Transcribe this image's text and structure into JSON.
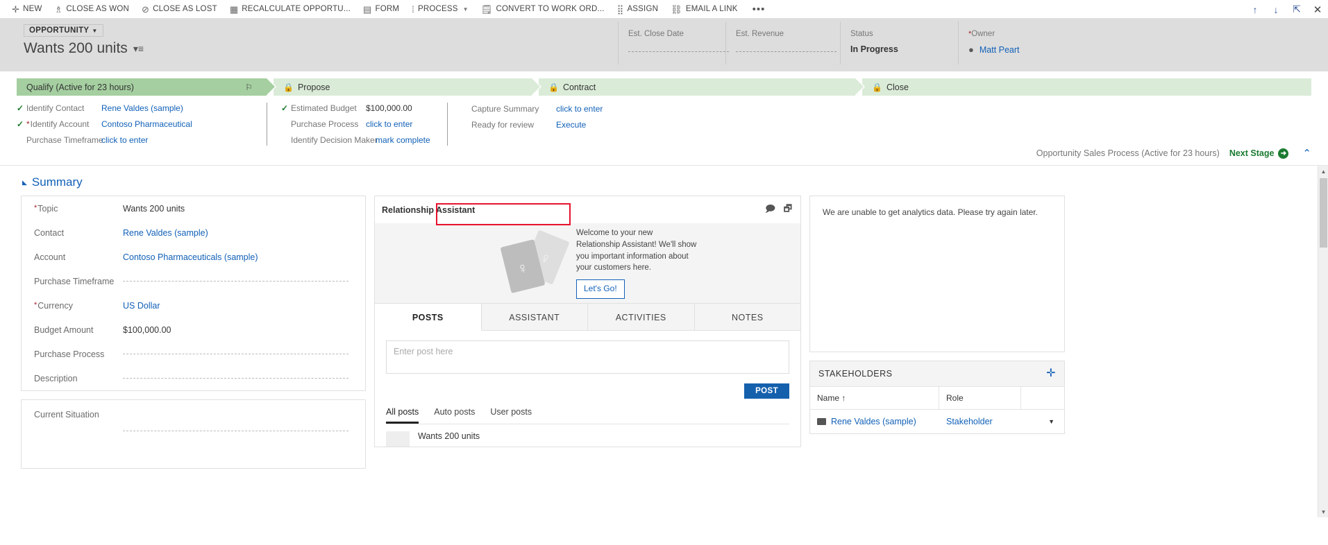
{
  "commandbar": {
    "items": [
      {
        "label": "NEW",
        "icon": "plus-icon",
        "glyph": "✚",
        "caret": false
      },
      {
        "label": "CLOSE AS WON",
        "icon": "trophy-icon",
        "glyph": "🏆",
        "caret": false
      },
      {
        "label": "CLOSE AS LOST",
        "icon": "block-icon",
        "glyph": "🚫",
        "caret": false
      },
      {
        "label": "RECALCULATE OPPORTU...",
        "icon": "calculator-icon",
        "glyph": "🖩",
        "caret": false
      },
      {
        "label": "FORM",
        "icon": "form-icon",
        "glyph": "▤",
        "caret": false
      },
      {
        "label": "PROCESS",
        "icon": "process-icon",
        "glyph": "⁞",
        "caret": true
      },
      {
        "label": "CONVERT TO WORK ORD...",
        "icon": "convert-icon",
        "glyph": "📝",
        "caret": false
      },
      {
        "label": "ASSIGN",
        "icon": "assign-icon",
        "glyph": "👥",
        "caret": false
      },
      {
        "label": "EMAIL A LINK",
        "icon": "link-icon",
        "glyph": "🔗",
        "caret": false
      }
    ],
    "overflow_label": "•••",
    "right_icons": [
      {
        "name": "move-up-icon",
        "glyph": "↑"
      },
      {
        "name": "move-down-icon",
        "glyph": "↓"
      },
      {
        "name": "popout-icon",
        "glyph": "⇱"
      },
      {
        "name": "close-icon",
        "glyph": "✕"
      }
    ]
  },
  "header": {
    "entity_type": "OPPORTUNITY",
    "record_title": "Wants 200 units",
    "fields": [
      {
        "label": "Est. Close Date",
        "value": "",
        "empty": true,
        "required": false,
        "link": false
      },
      {
        "label": "Est. Revenue",
        "value": "",
        "empty": true,
        "required": false,
        "link": false
      },
      {
        "label": "Status",
        "value": "In Progress",
        "empty": false,
        "required": false,
        "link": false
      },
      {
        "label": "Owner",
        "value": "Matt Peart",
        "empty": false,
        "required": true,
        "link": true
      }
    ]
  },
  "process": {
    "stages": [
      {
        "label": "Qualify (Active for 23 hours)",
        "active": true,
        "locked": false
      },
      {
        "label": "Propose",
        "active": false,
        "locked": true
      },
      {
        "label": "Contract",
        "active": false,
        "locked": true
      },
      {
        "label": "Close",
        "active": false,
        "locked": true
      }
    ],
    "step_groups": [
      {
        "steps": [
          {
            "name": "Identify Contact",
            "value": "Rene Valdes (sample)",
            "complete": true,
            "required": false,
            "link": true
          },
          {
            "name": "Identify Account",
            "value": "Contoso Pharmaceutical",
            "complete": true,
            "required": true,
            "link": true
          },
          {
            "name": "Purchase Timeframe",
            "value": "click to enter",
            "complete": false,
            "required": false,
            "link": true
          }
        ]
      },
      {
        "steps": [
          {
            "name": "Estimated Budget",
            "value": "$100,000.00",
            "complete": true,
            "required": false,
            "link": false
          },
          {
            "name": "Purchase Process",
            "value": "click to enter",
            "complete": false,
            "required": false,
            "link": true
          },
          {
            "name": "Identify Decision Maker",
            "value": "mark complete",
            "complete": false,
            "required": false,
            "link": true
          }
        ]
      },
      {
        "steps": [
          {
            "name": "Capture Summary",
            "value": "click to enter",
            "complete": false,
            "required": false,
            "link": true
          },
          {
            "name": "Ready for review",
            "value": "Execute",
            "complete": false,
            "required": false,
            "link": true
          }
        ]
      }
    ],
    "process_name": "Opportunity Sales Process (Active for 23 hours)",
    "next_stage_label": "Next Stage",
    "collapse_icon": "chevron-up-icon",
    "highlight_color": "#e8112d"
  },
  "summary": {
    "section_label": "Summary",
    "fields": [
      {
        "label": "Topic",
        "value": "Wants 200 units",
        "required": true,
        "empty": false,
        "link": false
      },
      {
        "label": "Contact",
        "value": "Rene Valdes (sample)",
        "required": false,
        "empty": false,
        "link": true
      },
      {
        "label": "Account",
        "value": "Contoso Pharmaceuticals (sample)",
        "required": false,
        "empty": false,
        "link": true
      },
      {
        "label": "Purchase Timeframe",
        "value": "",
        "required": false,
        "empty": true,
        "link": false
      },
      {
        "label": "Currency",
        "value": "US Dollar",
        "required": true,
        "empty": false,
        "link": true
      },
      {
        "label": "Budget Amount",
        "value": "$100,000.00",
        "required": false,
        "empty": false,
        "link": false
      },
      {
        "label": "Purchase Process",
        "value": "",
        "required": false,
        "empty": true,
        "link": false
      },
      {
        "label": "Description",
        "value": "",
        "required": false,
        "empty": true,
        "link": false
      }
    ],
    "second_card": [
      {
        "label": "Current Situation",
        "value": "",
        "required": false,
        "empty": true,
        "link": false
      }
    ]
  },
  "relationship_assistant": {
    "title": "Relationship Assistant",
    "welcome_text": "Welcome to your new Relationship Assistant! We'll show you important information about your customers here.",
    "button_label": "Let's Go!",
    "head_icons": [
      {
        "name": "feedback-icon",
        "glyph": "🗩"
      },
      {
        "name": "cards-icon",
        "glyph": "🗗"
      }
    ]
  },
  "social_pane": {
    "tabs": [
      {
        "label": "POSTS",
        "active": true
      },
      {
        "label": "ASSISTANT",
        "active": false
      },
      {
        "label": "ACTIVITIES",
        "active": false
      },
      {
        "label": "NOTES",
        "active": false
      }
    ],
    "post_placeholder": "Enter post here",
    "post_button": "POST",
    "filters": [
      {
        "label": "All posts",
        "active": true
      },
      {
        "label": "Auto posts",
        "active": false
      },
      {
        "label": "User posts",
        "active": false
      }
    ],
    "posts": [
      {
        "title": "Wants 200 units"
      }
    ]
  },
  "analytics": {
    "message": "We are unable to get analytics data. Please try again later."
  },
  "stakeholders": {
    "title": "STAKEHOLDERS",
    "add_icon": "plus-icon",
    "columns": [
      "Name ↑",
      "Role",
      ""
    ],
    "rows": [
      {
        "name": "Rene Valdes (sample)",
        "role": "Stakeholder"
      }
    ]
  }
}
